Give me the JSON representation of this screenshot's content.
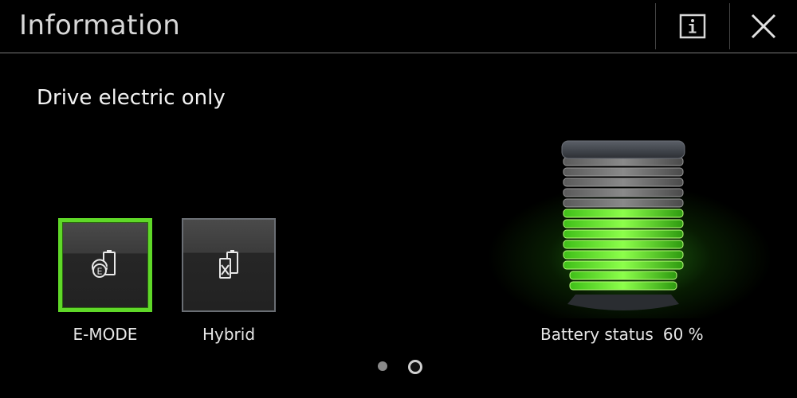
{
  "header": {
    "title": "Information",
    "info_icon": "info-icon",
    "close_icon": "close-icon"
  },
  "subtitle": "Drive electric only",
  "modes": [
    {
      "label": "E-MODE",
      "icon": "e-mode-battery-icon",
      "selected": true
    },
    {
      "label": "Hybrid",
      "icon": "hybrid-battery-icon",
      "selected": false
    }
  ],
  "battery": {
    "label": "Battery status",
    "percent_text": "60 %",
    "level": 0.6
  },
  "pagination": {
    "page_count": 2,
    "current_page": 2
  },
  "colors": {
    "accent": "#5fd828",
    "background": "#000000"
  }
}
